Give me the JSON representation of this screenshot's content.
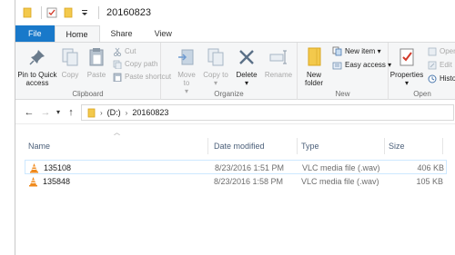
{
  "window": {
    "title": "20160823"
  },
  "tabs": {
    "file": "File",
    "home": "Home",
    "share": "Share",
    "view": "View"
  },
  "ribbon": {
    "clipboard": {
      "label": "Clipboard",
      "pin": "Pin to Quick access",
      "copy": "Copy",
      "paste": "Paste",
      "cut": "Cut",
      "copy_path": "Copy path",
      "paste_shortcut": "Paste shortcut"
    },
    "organize": {
      "label": "Organize",
      "move_to": "Move to",
      "copy_to": "Copy to",
      "delete": "Delete",
      "rename": "Rename"
    },
    "new": {
      "label": "New",
      "new_folder": "New folder",
      "new_item": "New item",
      "easy_access": "Easy access"
    },
    "open": {
      "label": "Open",
      "properties": "Properties",
      "open": "Open",
      "edit": "Edit",
      "history": "History"
    }
  },
  "address": {
    "drive": "(D:)",
    "folder": "20160823"
  },
  "columns": {
    "name": "Name",
    "date": "Date modified",
    "type": "Type",
    "size": "Size"
  },
  "files": [
    {
      "name": "135108",
      "date": "8/23/2016 1:51 PM",
      "type": "VLC media file (.wav)",
      "size": "406 KB"
    },
    {
      "name": "135848",
      "date": "8/23/2016 1:58 PM",
      "type": "VLC media file (.wav)",
      "size": "105 KB"
    }
  ]
}
